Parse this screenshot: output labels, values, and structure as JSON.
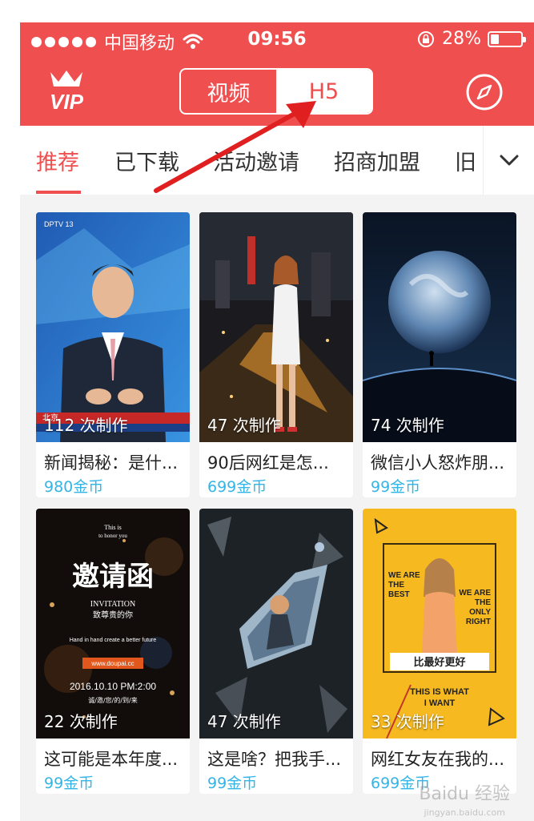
{
  "status_bar": {
    "carrier": "中国移动",
    "time": "09:56",
    "battery": "28%",
    "battery_level": 0.28
  },
  "header": {
    "vip_label": "VIP",
    "segments": [
      {
        "label": "视频",
        "active": false
      },
      {
        "label": "H5",
        "active": true
      }
    ],
    "accent_color": "#ef4f4f"
  },
  "tabs": {
    "items": [
      {
        "label": "推荐",
        "active": true
      },
      {
        "label": "已下载",
        "active": false
      },
      {
        "label": "活动邀请",
        "active": false
      },
      {
        "label": "招商加盟",
        "active": false
      },
      {
        "label": "旧",
        "active": false
      }
    ]
  },
  "cards": [
    {
      "title": "新闻揭秘：是什...",
      "price": "980金币",
      "count": "112 次制作",
      "thumb_text_top": "DPTV 13",
      "thumb_text_bottom": "北京"
    },
    {
      "title": "90后网红是怎...",
      "price": "699金币",
      "count": "47 次制作"
    },
    {
      "title": "微信小人怒炸朋...",
      "price": "99金币",
      "count": "74 次制作"
    },
    {
      "title": "这可能是本年度...",
      "price": "99金币",
      "count": "22 次制作",
      "thumb_lines": [
        "This is",
        "to honor you",
        "邀请函",
        "INVITATION",
        "致尊贵的你",
        "Hand in hand create a better future",
        "www.doupai.cc",
        "2016.10.10  PM:2:00",
        "诚/邀/您/的/到/来"
      ]
    },
    {
      "title": "这是啥？把我手...",
      "price": "99金币",
      "count": "47 次制作"
    },
    {
      "title": "网红女友在我的...",
      "price": "699金币",
      "count": "33 次制作",
      "thumb_lines": [
        "WE ARE THE BEST",
        "WE ARE THE ONLY RIGHT",
        "比最好更好",
        "THIS IS WHAT I WANT"
      ]
    }
  ],
  "watermark": {
    "text": "Baidu 经验",
    "sub": "jingyan.baidu.com"
  }
}
